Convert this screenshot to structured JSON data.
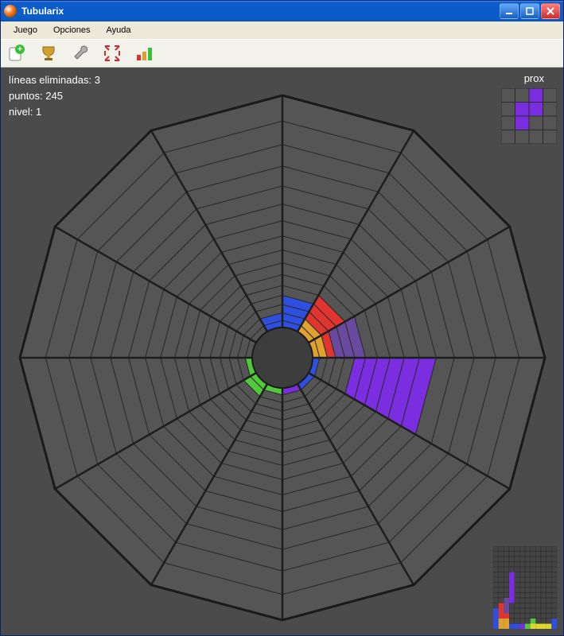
{
  "window": {
    "title": "Tubularix"
  },
  "menu": {
    "game": "Juego",
    "options": "Opciones",
    "help": "Ayuda"
  },
  "toolbar_icons": {
    "new": "new-game-icon",
    "scores": "scores-icon",
    "settings": "settings-icon",
    "fullscreen": "fullscreen-icon",
    "stats": "stats-icon"
  },
  "stats": {
    "lines_label": "líneas eliminadas:",
    "lines_value": "3",
    "points_label": "puntos:",
    "points_value": "245",
    "level_label": "nivel:",
    "level_value": "1"
  },
  "next": {
    "label": "prox"
  },
  "board": {
    "sectors": 12,
    "rows": 16,
    "inner_radius": 38,
    "outer_radius": 330,
    "row_growth": 1.09,
    "colors": {
      "grid": "#2a2a2a",
      "empty": "#555555",
      "blue": "#2e4fe0",
      "red": "#e0342e",
      "orange": "#e0a22e",
      "green": "#52c83c",
      "purple": "#7a2ee0",
      "purple_dim": "#6a4a9e",
      "yellow": "#e0d62e"
    },
    "cells": [
      {
        "sector": 0,
        "row": 0,
        "color": "blue"
      },
      {
        "sector": 0,
        "row": 1,
        "color": "blue"
      },
      {
        "sector": 0,
        "row": 2,
        "color": "blue"
      },
      {
        "sector": 0,
        "row": 3,
        "color": "blue"
      },
      {
        "sector": 1,
        "row": 0,
        "color": "orange"
      },
      {
        "sector": 1,
        "row": 1,
        "color": "orange"
      },
      {
        "sector": 1,
        "row": 2,
        "color": "red"
      },
      {
        "sector": 1,
        "row": 3,
        "color": "red"
      },
      {
        "sector": 1,
        "row": 4,
        "color": "red"
      },
      {
        "sector": 2,
        "row": 0,
        "color": "orange"
      },
      {
        "sector": 2,
        "row": 1,
        "color": "orange"
      },
      {
        "sector": 2,
        "row": 2,
        "color": "red"
      },
      {
        "sector": 2,
        "row": 3,
        "color": "purple_dim"
      },
      {
        "sector": 2,
        "row": 4,
        "color": "purple_dim"
      },
      {
        "sector": 2,
        "row": 5,
        "color": "purple_dim"
      },
      {
        "sector": 3,
        "row": 0,
        "color": "blue"
      },
      {
        "sector": 3,
        "row": 5,
        "color": "purple"
      },
      {
        "sector": 3,
        "row": 6,
        "color": "purple"
      },
      {
        "sector": 3,
        "row": 7,
        "color": "purple"
      },
      {
        "sector": 3,
        "row": 8,
        "color": "purple"
      },
      {
        "sector": 3,
        "row": 9,
        "color": "purple"
      },
      {
        "sector": 3,
        "row": 10,
        "color": "purple"
      },
      {
        "sector": 4,
        "row": 0,
        "color": "blue"
      },
      {
        "sector": 5,
        "row": 0,
        "color": "purple"
      },
      {
        "sector": 6,
        "row": 0,
        "color": "green"
      },
      {
        "sector": 7,
        "row": 0,
        "color": "green"
      },
      {
        "sector": 7,
        "row": 1,
        "color": "green"
      },
      {
        "sector": 8,
        "row": 0,
        "color": "green"
      },
      {
        "sector": 11,
        "row": 0,
        "color": "blue"
      },
      {
        "sector": 11,
        "row": 1,
        "color": "blue"
      }
    ]
  },
  "next_piece": {
    "grid": 4,
    "color": "purple",
    "cells": [
      [
        2,
        0
      ],
      [
        2,
        1
      ],
      [
        1,
        1
      ],
      [
        1,
        2
      ]
    ]
  },
  "minimap": {
    "cols": 12,
    "rows": 16,
    "cells": [
      {
        "c": 0,
        "r": 15,
        "color": "blue"
      },
      {
        "c": 0,
        "r": 14,
        "color": "blue"
      },
      {
        "c": 0,
        "r": 13,
        "color": "blue"
      },
      {
        "c": 0,
        "r": 12,
        "color": "blue"
      },
      {
        "c": 1,
        "r": 15,
        "color": "orange"
      },
      {
        "c": 1,
        "r": 14,
        "color": "orange"
      },
      {
        "c": 1,
        "r": 13,
        "color": "red"
      },
      {
        "c": 1,
        "r": 12,
        "color": "red"
      },
      {
        "c": 1,
        "r": 11,
        "color": "red"
      },
      {
        "c": 2,
        "r": 15,
        "color": "orange"
      },
      {
        "c": 2,
        "r": 14,
        "color": "orange"
      },
      {
        "c": 2,
        "r": 13,
        "color": "red"
      },
      {
        "c": 2,
        "r": 12,
        "color": "purple_dim"
      },
      {
        "c": 2,
        "r": 11,
        "color": "purple_dim"
      },
      {
        "c": 2,
        "r": 10,
        "color": "purple_dim"
      },
      {
        "c": 3,
        "r": 15,
        "color": "blue"
      },
      {
        "c": 3,
        "r": 10,
        "color": "purple"
      },
      {
        "c": 3,
        "r": 9,
        "color": "purple"
      },
      {
        "c": 3,
        "r": 8,
        "color": "purple"
      },
      {
        "c": 3,
        "r": 7,
        "color": "purple"
      },
      {
        "c": 3,
        "r": 6,
        "color": "purple"
      },
      {
        "c": 3,
        "r": 5,
        "color": "purple"
      },
      {
        "c": 4,
        "r": 15,
        "color": "blue"
      },
      {
        "c": 5,
        "r": 15,
        "color": "purple"
      },
      {
        "c": 6,
        "r": 15,
        "color": "green"
      },
      {
        "c": 7,
        "r": 15,
        "color": "yellow"
      },
      {
        "c": 7,
        "r": 14,
        "color": "green"
      },
      {
        "c": 8,
        "r": 15,
        "color": "yellow"
      },
      {
        "c": 9,
        "r": 15,
        "color": "yellow"
      },
      {
        "c": 10,
        "r": 15,
        "color": "yellow"
      },
      {
        "c": 11,
        "r": 15,
        "color": "blue"
      },
      {
        "c": 11,
        "r": 14,
        "color": "blue"
      }
    ]
  }
}
